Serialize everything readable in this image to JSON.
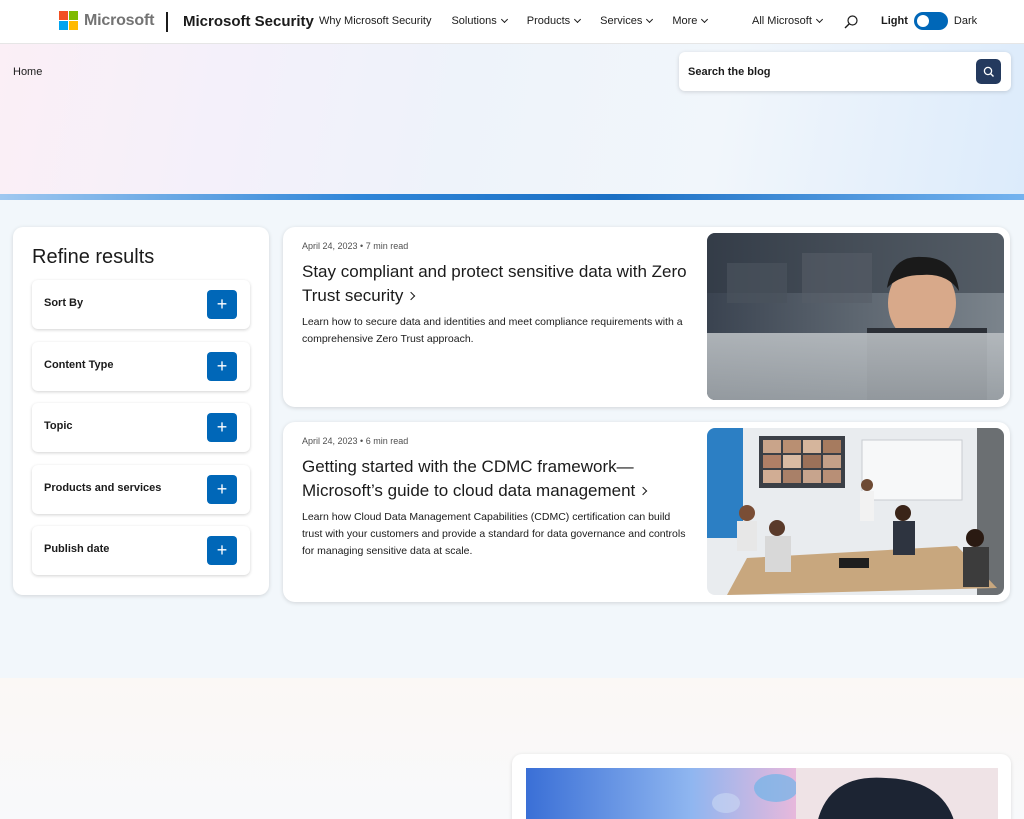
{
  "nav": {
    "logo_text": "Microsoft",
    "brand": "Microsoft Security",
    "links": [
      "Why Microsoft Security",
      "Solutions",
      "Products",
      "Services",
      "More"
    ],
    "all_microsoft": "All Microsoft",
    "theme_light": "Light",
    "theme_dark": "Dark",
    "theme_state": "light"
  },
  "breadcrumb": "Home",
  "search": {
    "placeholder": "Search the blog"
  },
  "refine": {
    "title": "Refine results",
    "facets": [
      "Sort By",
      "Content Type",
      "Topic",
      "Products and services",
      "Publish date"
    ]
  },
  "articles": [
    {
      "meta": "April 24, 2023 • 7 min read",
      "title": "Stay compliant and protect sensitive data with Zero Trust security",
      "description": "Learn how to secure data and identities and meet compliance requirements with a comprehensive Zero Trust approach."
    },
    {
      "meta": "April 24, 2023 • 6 min read",
      "title": "Getting started with the CDMC framework—Microsoft’s guide to cloud data management",
      "description": "Learn how Cloud Data Management Capabilities (CDMC) certification can build trust with your customers and provide a standard for data governance and controls for managing sensitive data at scale."
    }
  ],
  "colors": {
    "accent": "#0067b8",
    "search_button": "#243a5e",
    "ms_red": "#f25022",
    "ms_green": "#7fba00",
    "ms_blue": "#00a4ef",
    "ms_yellow": "#ffb900"
  }
}
